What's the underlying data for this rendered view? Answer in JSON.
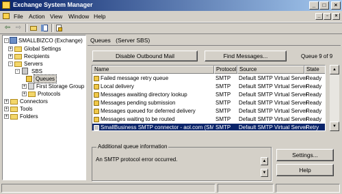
{
  "window": {
    "title": "Exchange System Manager",
    "controls": [
      "_",
      "□",
      "×"
    ]
  },
  "menu": [
    "File",
    "Action",
    "View",
    "Window",
    "Help"
  ],
  "toolbar": {
    "icons": [
      "back-icon",
      "forward-icon",
      "up-folder-icon",
      "show-hide-tree-icon",
      "properties-icon"
    ]
  },
  "tree": {
    "root": "SMALLBIZCO (Exchange)",
    "global_settings": "Global Settings",
    "recipients": "Recipients",
    "servers": "Servers",
    "sbs": "SBS",
    "queues": "Queues",
    "storage_group": "First Storage Group",
    "protocols": "Protocols",
    "connectors": "Connectors",
    "tools": "Tools",
    "folders": "Folders"
  },
  "right": {
    "header_queues": "Queues",
    "header_server": "(Server SBS)",
    "disable_button": "Disable Outbound Mail",
    "find_button": "Find Messages...",
    "queue_count": "Queue 9 of 9",
    "columns": [
      "Name",
      "Protocol",
      "Source",
      "State"
    ],
    "rows": [
      {
        "name": "Failed message retry queue",
        "protocol": "SMTP",
        "source": "Default SMTP Virtual Server",
        "state": "Ready"
      },
      {
        "name": "Local delivery",
        "protocol": "SMTP",
        "source": "Default SMTP Virtual Server",
        "state": "Ready"
      },
      {
        "name": "Messages awaiting directory lookup",
        "protocol": "SMTP",
        "source": "Default SMTP Virtual Server",
        "state": "Ready"
      },
      {
        "name": "Messages pending submission",
        "protocol": "SMTP",
        "source": "Default SMTP Virtual Server",
        "state": "Ready"
      },
      {
        "name": "Messages queued for deferred delivery",
        "protocol": "SMTP",
        "source": "Default SMTP Virtual Server",
        "state": "Ready"
      },
      {
        "name": "Messages waiting to be routed",
        "protocol": "SMTP",
        "source": "Default SMTP Virtual Server",
        "state": "Ready"
      },
      {
        "name": "SmallBusiness SMTP connector - aol.com (SMT...",
        "protocol": "SMTP",
        "source": "Default SMTP Virtual Server",
        "state": "Retry"
      }
    ],
    "info_legend": "Additional queue information",
    "info_text": "An SMTP protocol error occurred.",
    "settings_button": "Settings...",
    "help_button": "Help"
  },
  "colors": {
    "title_start": "#0a246a",
    "title_end": "#a6caf0",
    "selection": "#0a246a",
    "face": "#d4d0c8"
  }
}
